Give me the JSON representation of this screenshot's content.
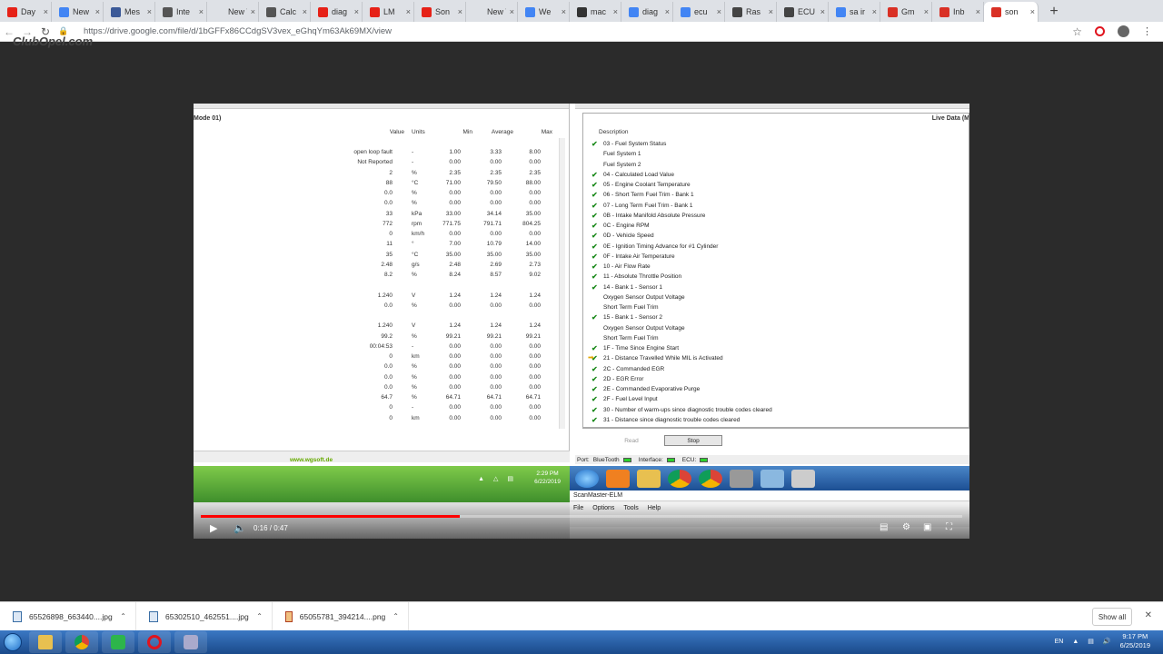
{
  "browser": {
    "tabs": [
      {
        "label": "Day",
        "color": "#e62117",
        "icon": "youtube-icon"
      },
      {
        "label": "New",
        "color": "#4285f4",
        "icon": "extension-icon"
      },
      {
        "label": "Mes",
        "color": "#3b5998",
        "icon": "facebook-icon"
      },
      {
        "label": "Inte",
        "color": "#555555",
        "icon": "instagram-icon"
      },
      {
        "label": "New Tab",
        "color": "#dee1e6",
        "icon": "blank-icon"
      },
      {
        "label": "Calc",
        "color": "#555555",
        "icon": "calculator-icon"
      },
      {
        "label": "diag",
        "color": "#e62117",
        "icon": "youtube-icon"
      },
      {
        "label": "LM",
        "color": "#e62117",
        "icon": "youtube-icon"
      },
      {
        "label": "Son",
        "color": "#e62117",
        "icon": "youtube-icon"
      },
      {
        "label": "New Tab",
        "color": "#dee1e6",
        "icon": "blank-icon"
      },
      {
        "label": "We",
        "color": "#4285f4",
        "icon": "google-icon"
      },
      {
        "label": "mac",
        "color": "#333333",
        "icon": "bag-icon"
      },
      {
        "label": "diag",
        "color": "#4285f4",
        "icon": "google-icon"
      },
      {
        "label": "ecu",
        "color": "#4285f4",
        "icon": "google-icon"
      },
      {
        "label": "Ras",
        "color": "#444444",
        "icon": "image-icon"
      },
      {
        "label": "ECU",
        "color": "#444444",
        "icon": "globe-icon"
      },
      {
        "label": "sa ir",
        "color": "#4285f4",
        "icon": "google-icon"
      },
      {
        "label": "Gm",
        "color": "#d93025",
        "icon": "gmail-icon"
      },
      {
        "label": "Inb",
        "color": "#d93025",
        "icon": "gmail-icon"
      },
      {
        "label": "son",
        "color": "#d93025",
        "icon": "calendar-icon",
        "active": true
      }
    ],
    "url": "https://drive.google.com/file/d/1bGFFx86CCdgSV3vex_eGhqYm63Ak69MX/view"
  },
  "watermark": "ClubOpel.com",
  "video": {
    "left_panel": {
      "mode": "Mode 01)",
      "headers": {
        "value": "Value",
        "units": "Units",
        "min": "Min",
        "average": "Average",
        "max": "Max"
      },
      "rows": [
        {
          "value": "open loop fault",
          "units": "-",
          "min": "1.00",
          "avg": "3.33",
          "max": "8.00"
        },
        {
          "value": "Not Reported",
          "units": "-",
          "min": "0.00",
          "avg": "0.00",
          "max": "0.00"
        },
        {
          "value": "2",
          "units": "%",
          "min": "2.35",
          "avg": "2.35",
          "max": "2.35"
        },
        {
          "value": "88",
          "units": "°C",
          "min": "71.00",
          "avg": "79.50",
          "max": "88.00"
        },
        {
          "value": "0.0",
          "units": "%",
          "min": "0.00",
          "avg": "0.00",
          "max": "0.00"
        },
        {
          "value": "0.0",
          "units": "%",
          "min": "0.00",
          "avg": "0.00",
          "max": "0.00"
        },
        {
          "value": "33",
          "units": "kPa",
          "min": "33.00",
          "avg": "34.14",
          "max": "35.00"
        },
        {
          "value": "772",
          "units": "rpm",
          "min": "771.75",
          "avg": "791.71",
          "max": "804.25"
        },
        {
          "value": "0",
          "units": "km/h",
          "min": "0.00",
          "avg": "0.00",
          "max": "0.00"
        },
        {
          "value": "11",
          "units": "°",
          "min": "7.00",
          "avg": "10.79",
          "max": "14.00"
        },
        {
          "value": "35",
          "units": "°C",
          "min": "35.00",
          "avg": "35.00",
          "max": "35.00"
        },
        {
          "value": "2.48",
          "units": "g/s",
          "min": "2.48",
          "avg": "2.69",
          "max": "2.73"
        },
        {
          "value": "8.2",
          "units": "%",
          "min": "8.24",
          "avg": "8.57",
          "max": "9.02"
        },
        {
          "value": "",
          "units": "",
          "min": "",
          "avg": "",
          "max": ""
        },
        {
          "value": "1.240",
          "units": "V",
          "min": "1.24",
          "avg": "1.24",
          "max": "1.24"
        },
        {
          "value": "0.0",
          "units": "%",
          "min": "0.00",
          "avg": "0.00",
          "max": "0.00"
        },
        {
          "value": "",
          "units": "",
          "min": "",
          "avg": "",
          "max": ""
        },
        {
          "value": "1.240",
          "units": "V",
          "min": "1.24",
          "avg": "1.24",
          "max": "1.24"
        },
        {
          "value": "99.2",
          "units": "%",
          "min": "99.21",
          "avg": "99.21",
          "max": "99.21"
        },
        {
          "value": "00:04:53",
          "units": "-",
          "min": "0.00",
          "avg": "0.00",
          "max": "0.00"
        },
        {
          "value": "0",
          "units": "km",
          "min": "0.00",
          "avg": "0.00",
          "max": "0.00"
        },
        {
          "value": "0.0",
          "units": "%",
          "min": "0.00",
          "avg": "0.00",
          "max": "0.00"
        },
        {
          "value": "0.0",
          "units": "%",
          "min": "0.00",
          "avg": "0.00",
          "max": "0.00"
        },
        {
          "value": "0.0",
          "units": "%",
          "min": "0.00",
          "avg": "0.00",
          "max": "0.00"
        },
        {
          "value": "64.7",
          "units": "%",
          "min": "64.71",
          "avg": "64.71",
          "max": "64.71"
        },
        {
          "value": "0",
          "units": "-",
          "min": "0.00",
          "avg": "0.00",
          "max": "0.00"
        },
        {
          "value": "0",
          "units": "km",
          "min": "0.00",
          "avg": "0.00",
          "max": "0.00"
        }
      ],
      "website": "www.wgsoft.de",
      "tray_time": "2:29 PM",
      "tray_date": "6/22/2019"
    },
    "right_panel": {
      "title": "Live Data (M",
      "description_header": "Description",
      "rows": [
        {
          "text": "03 - Fuel System Status",
          "check": true
        },
        {
          "text": "Fuel System 1",
          "check": false
        },
        {
          "text": "Fuel System 2",
          "check": false
        },
        {
          "text": "04 - Calculated Load Value",
          "check": true
        },
        {
          "text": "05 - Engine Coolant Temperature",
          "check": true
        },
        {
          "text": "06 - Short Term Fuel Trim - Bank 1",
          "check": true
        },
        {
          "text": "07 - Long Term Fuel Trim - Bank 1",
          "check": true
        },
        {
          "text": "0B - Intake Manifold Absolute Pressure",
          "check": true
        },
        {
          "text": "0C - Engine RPM",
          "check": true
        },
        {
          "text": "0D - Vehicle Speed",
          "check": true
        },
        {
          "text": "0E - Ignition Timing Advance for #1 Cylinder",
          "check": true
        },
        {
          "text": "0F - Intake Air Temperature",
          "check": true
        },
        {
          "text": "10 - Air Flow Rate",
          "check": true
        },
        {
          "text": "11 - Absolute Throttle Position",
          "check": true
        },
        {
          "text": "14 - Bank 1 - Sensor 1",
          "check": true
        },
        {
          "text": "Oxygen Sensor Output Voltage",
          "check": false
        },
        {
          "text": "Short Term Fuel Trim",
          "check": false
        },
        {
          "text": "15 - Bank 1 - Sensor 2",
          "check": true
        },
        {
          "text": "Oxygen Sensor Output Voltage",
          "check": false
        },
        {
          "text": "Short Term Fuel Trim",
          "check": false
        },
        {
          "text": "1F - Time Since Engine Start",
          "check": true
        },
        {
          "text": "21 - Distance Travelled While MIL is Activated",
          "check": true,
          "arrow": true
        },
        {
          "text": "2C - Commanded EGR",
          "check": true
        },
        {
          "text": "2D - EGR Error",
          "check": true
        },
        {
          "text": "2E - Commanded Evaporative Purge",
          "check": true
        },
        {
          "text": "2F - Fuel Level Input",
          "check": true
        },
        {
          "text": "30 - Number of warm-ups since diagnostic trouble codes cleared",
          "check": true
        },
        {
          "text": "31 - Distance since diagnostic trouble codes cleared",
          "check": true
        }
      ],
      "read_label": "Read",
      "stop_label": "Stop",
      "port_label": "Port:",
      "bluetooth_label": "BlueTooth",
      "interface_label": "Interface:",
      "ecu_label": "ECU:",
      "app_title": "ScanMaster-ELM",
      "menu": [
        "File",
        "Options",
        "Tools",
        "Help"
      ]
    },
    "player": {
      "time": "0:16 / 0:47",
      "progress": 0.34
    }
  },
  "downloads": {
    "items": [
      {
        "name": "65526898_663440....jpg",
        "type": "jpg"
      },
      {
        "name": "65302510_462551....jpg",
        "type": "jpg"
      },
      {
        "name": "65055781_394214....png",
        "type": "png"
      }
    ],
    "show_all": "Show all"
  },
  "taskbar": {
    "lang": "EN",
    "time": "9:17 PM",
    "date": "6/25/2019"
  }
}
